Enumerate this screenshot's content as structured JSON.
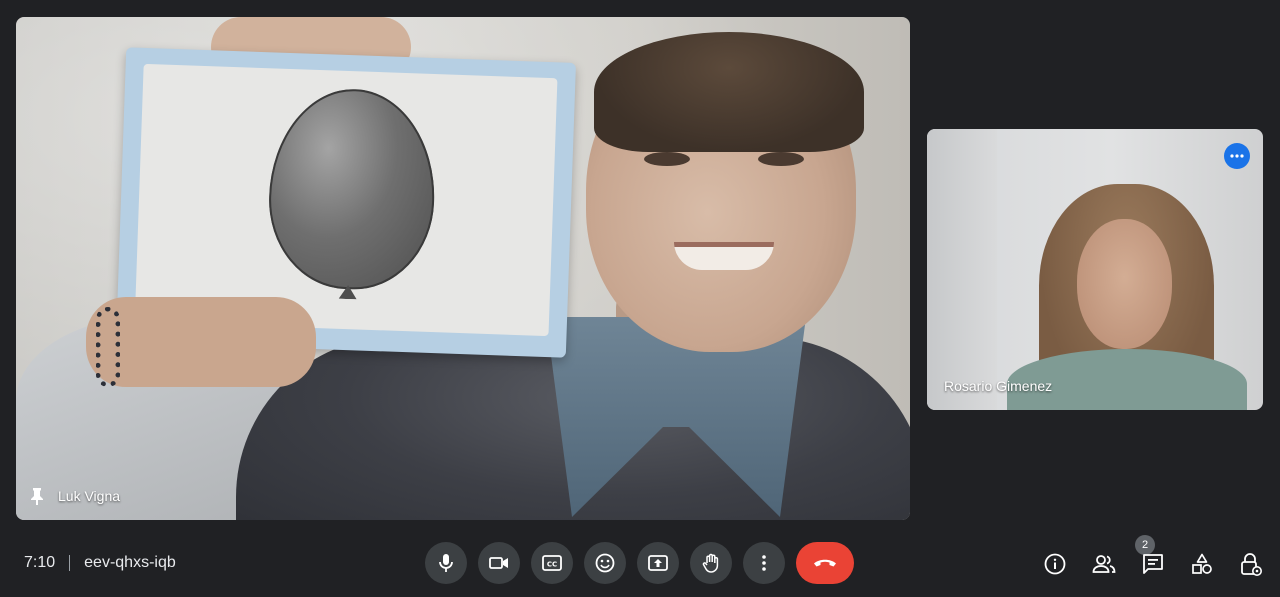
{
  "main_participant": {
    "name": "Luk Vigna"
  },
  "side_participant": {
    "name": "Rosario Gimenez"
  },
  "meeting": {
    "time": "7:10",
    "code": "eev-qhxs-iqb"
  },
  "people": {
    "count": "2"
  },
  "colors": {
    "background": "#202124",
    "control": "#3c4043",
    "end_call": "#ea4335",
    "accent": "#1a73e8"
  },
  "controls": [
    {
      "icon": "microphone-icon"
    },
    {
      "icon": "camera-icon"
    },
    {
      "icon": "captions-icon"
    },
    {
      "icon": "emoji-icon"
    },
    {
      "icon": "present-screen-icon"
    },
    {
      "icon": "raise-hand-icon"
    },
    {
      "icon": "more-options-icon"
    },
    {
      "icon": "end-call-icon"
    }
  ],
  "right_tools": [
    {
      "icon": "info-icon"
    },
    {
      "icon": "people-icon"
    },
    {
      "icon": "chat-icon"
    },
    {
      "icon": "activities-icon"
    },
    {
      "icon": "host-controls-icon"
    }
  ]
}
